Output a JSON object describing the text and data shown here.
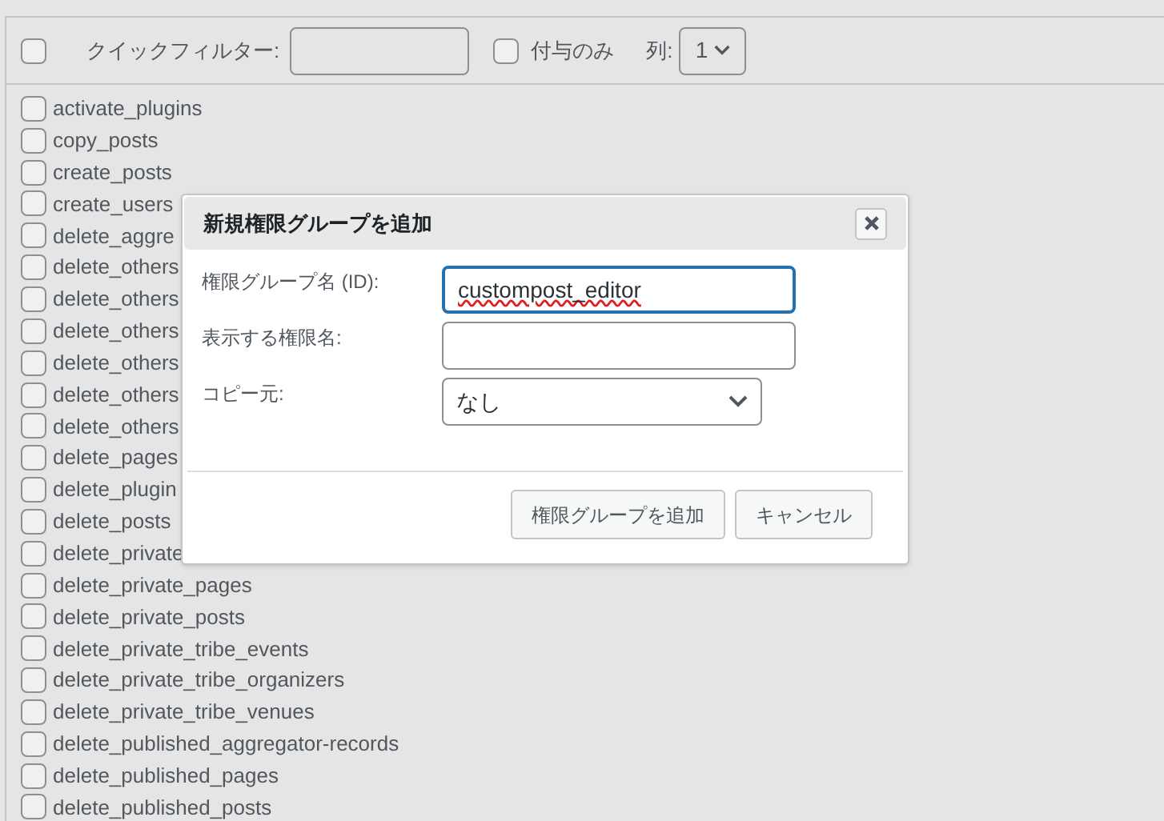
{
  "toolbar": {
    "select_all_checked": false,
    "quick_filter_label": "クイックフィルター:",
    "granted_only": {
      "label": "付与のみ",
      "checked": false
    },
    "columns_label": "列:",
    "columns_value": "1"
  },
  "capabilities": [
    {
      "label": "activate_plugins",
      "checked": false
    },
    {
      "label": "copy_posts",
      "checked": false
    },
    {
      "label": "create_posts",
      "checked": false
    },
    {
      "label": "create_users",
      "checked": false
    },
    {
      "label": "delete_aggre",
      "checked": false
    },
    {
      "label": "delete_others",
      "checked": false
    },
    {
      "label": "delete_others",
      "checked": false
    },
    {
      "label": "delete_others",
      "checked": false
    },
    {
      "label": "delete_others",
      "checked": false
    },
    {
      "label": "delete_others",
      "checked": false
    },
    {
      "label": "delete_others",
      "checked": false
    },
    {
      "label": "delete_pages",
      "checked": false
    },
    {
      "label": "delete_plugin",
      "checked": false
    },
    {
      "label": "delete_posts",
      "checked": false
    },
    {
      "label": "delete_private",
      "checked": false
    },
    {
      "label": "delete_private_pages",
      "checked": false
    },
    {
      "label": "delete_private_posts",
      "checked": false
    },
    {
      "label": "delete_private_tribe_events",
      "checked": false
    },
    {
      "label": "delete_private_tribe_organizers",
      "checked": false
    },
    {
      "label": "delete_private_tribe_venues",
      "checked": false
    },
    {
      "label": "delete_published_aggregator-records",
      "checked": false
    },
    {
      "label": "delete_published_pages",
      "checked": false
    },
    {
      "label": "delete_published_posts",
      "checked": false
    }
  ],
  "dialog": {
    "title": "新規権限グループを追加",
    "fields": [
      {
        "kind": "text",
        "label": "権限グループ名 (ID):",
        "value": "custompost_editor",
        "focused": true
      },
      {
        "kind": "text",
        "label": "表示する権限名:",
        "focused": false
      },
      {
        "kind": "select",
        "label": "コピー元:",
        "value": "なし",
        "focused": false
      }
    ],
    "buttons": [
      {
        "label": "権限グループを追加"
      },
      {
        "label": "キャンセル"
      }
    ]
  }
}
